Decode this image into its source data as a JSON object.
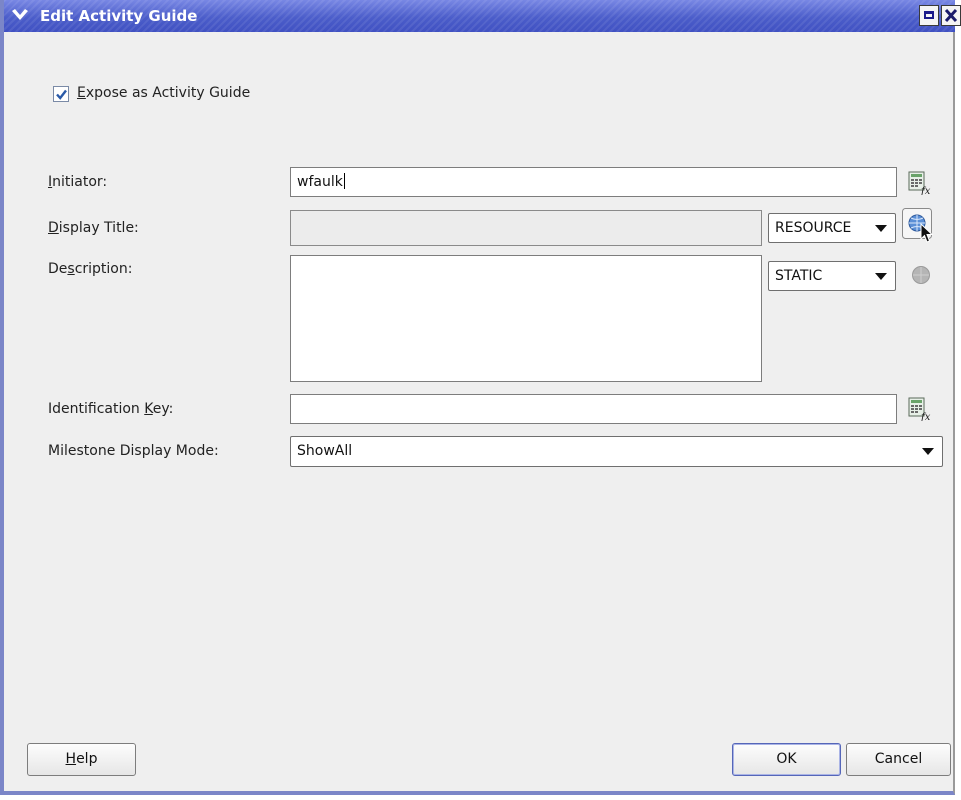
{
  "window": {
    "title": "Edit Activity Guide"
  },
  "expose_checkbox": {
    "label_mnemonic": "E",
    "label_rest": "xpose as Activity Guide",
    "checked": true
  },
  "fields": {
    "initiator": {
      "label_mnemonic": "I",
      "label_rest": "nitiator:",
      "value": "wfaulk"
    },
    "display_title": {
      "label_mnemonic": "D",
      "label_rest": "isplay Title:",
      "value": "",
      "mode": "RESOURCE"
    },
    "description": {
      "label_pre": "De",
      "label_mnemonic": "s",
      "label_rest": "cription:",
      "value": "",
      "mode": "STATIC"
    },
    "identification_key": {
      "label_pre": "Identification ",
      "label_mnemonic": "K",
      "label_rest": "ey:",
      "value": ""
    },
    "milestone_display_mode": {
      "label": "Milestone Display Mode:",
      "value": "ShowAll"
    }
  },
  "buttons": {
    "help_mnemonic": "H",
    "help_rest": "elp",
    "ok": "OK",
    "cancel": "Cancel"
  },
  "icons": {
    "expression": "expression-builder-icon",
    "globe": "translation-globe-icon",
    "disabled_globe": "disabled-globe-icon",
    "cursor": "mouse-pointer-icon"
  },
  "colors": {
    "titlebar": "#4a5cc9",
    "dialog_bg": "#efefef",
    "check": "#2a5aa8"
  }
}
